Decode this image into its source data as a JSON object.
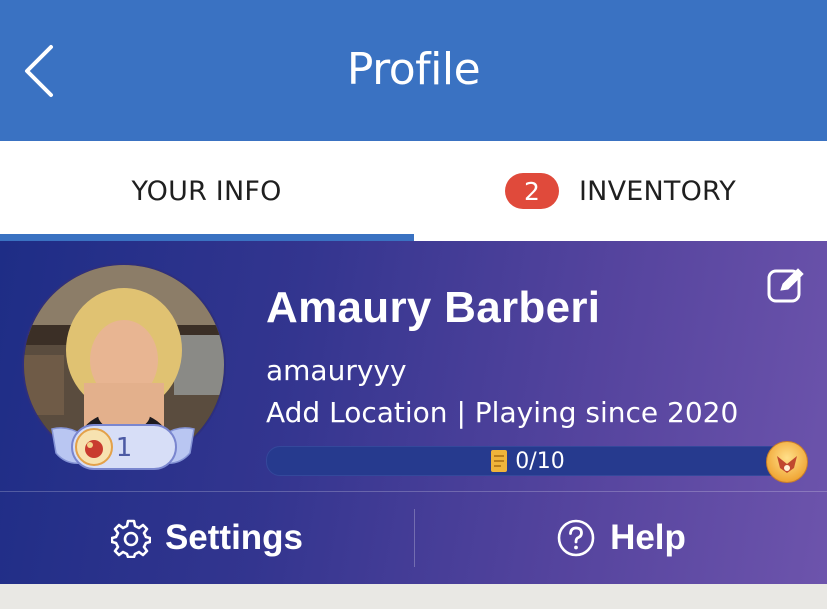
{
  "header": {
    "title": "Profile",
    "back_icon": "chevron-left-icon"
  },
  "tabs": [
    {
      "label": "YOUR INFO",
      "active": true
    },
    {
      "label": "INVENTORY",
      "badge": "2",
      "active": false
    }
  ],
  "profile": {
    "name": "Amaury Barberi",
    "username": "amauryyy",
    "location_link": "Add Location",
    "separator": "|",
    "playing_since": "Playing since 2020",
    "level": "1",
    "progress_text": "0/10",
    "progress_fraction": 0
  },
  "actions": {
    "settings_label": "Settings",
    "help_label": "Help"
  },
  "colors": {
    "header_blue": "#3a72c2",
    "badge_red": "#e04a3b",
    "card_gradient_start": "#1e2d86",
    "card_gradient_end": "#6d54ac"
  }
}
